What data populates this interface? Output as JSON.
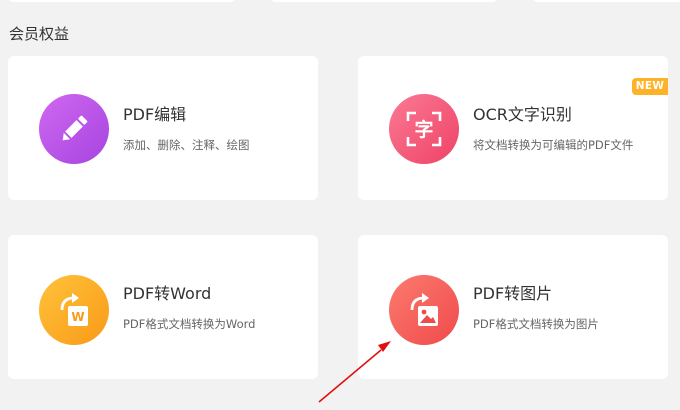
{
  "section": {
    "title": "会员权益"
  },
  "cards": [
    {
      "title": "PDF编辑",
      "desc": "添加、删除、注释、绘图",
      "icon": "pencil-icon",
      "color": "#b752e8"
    },
    {
      "title": "OCR文字识别",
      "desc": "将文档转换为可编辑的PDF文件",
      "icon": "ocr-character-icon",
      "icon_char": "字",
      "badge": "NEW",
      "color": "#f4587a"
    },
    {
      "title": "PDF转Word",
      "desc": "PDF格式文档转换为Word",
      "icon": "word-convert-icon",
      "icon_char": "W",
      "color": "#fca21f"
    },
    {
      "title": "PDF转图片",
      "desc": "PDF格式文档转换为图片",
      "icon": "image-convert-icon",
      "color": "#f4575a"
    }
  ],
  "colors": {
    "background": "#f2f2f2",
    "card": "#ffffff",
    "badge": "#fdb22a",
    "annotation_arrow": "#e01010"
  }
}
